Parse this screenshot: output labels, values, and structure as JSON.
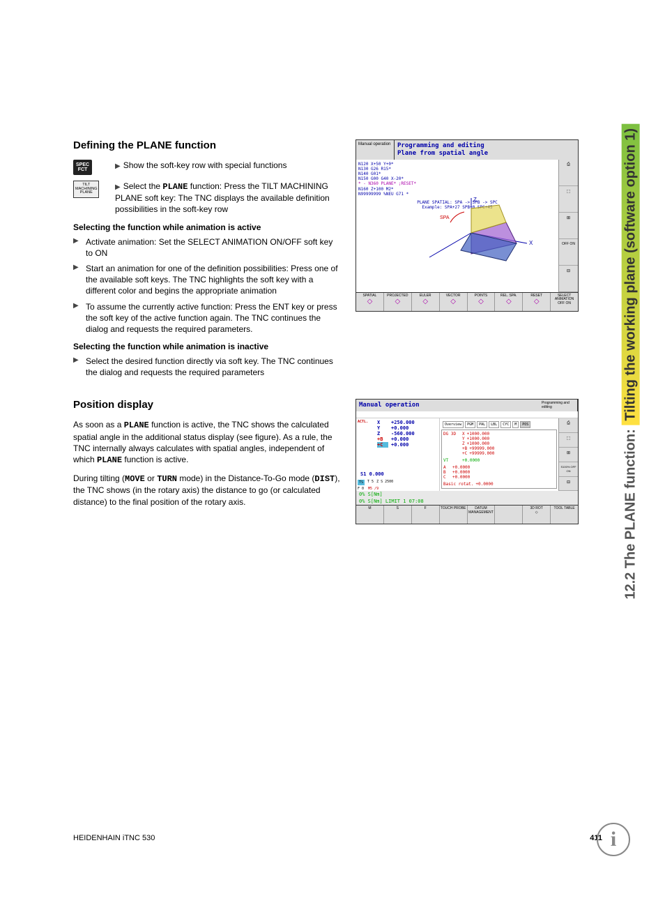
{
  "side_tab": {
    "prefix": "12.2 The PLANE function: ",
    "highlight": "Tilting the working plane (software option 1)"
  },
  "section1": {
    "heading": "Defining the PLANE function",
    "step1": {
      "icon_l1": "SPEC",
      "icon_l2": "FCT",
      "text": "Show the soft-key row with special functions"
    },
    "step2": {
      "icon_l1": "TILT",
      "icon_l2": "MACHINING",
      "icon_l3": "PLANE",
      "pre": "Select the ",
      "bold": "PLANE",
      "post": " function: Press the TILT MACHINING PLANE soft key: The TNC displays the available definition possibilities in the soft-key row"
    },
    "sub1": "Selecting the function while animation is active",
    "b1": "Activate animation: Set the SELECT ANIMATION ON/OFF soft key to ON",
    "b2": "Start an animation for one of the definition possibilities: Press one of the available soft keys. The TNC highlights the soft key with a different color and begins the appropriate animation",
    "b3": "To assume the currently active function: Press the ENT key or press the soft key of the active function again. The TNC continues the dialog and requests the required parameters.",
    "sub2": "Selecting the function while animation is inactive",
    "b4": "Select the desired function directly via soft key. The TNC continues the dialog and requests the required parameters"
  },
  "section2": {
    "heading": "Position display",
    "p1_a": "As soon as a ",
    "p1_b": "PLANE",
    "p1_c": " function is active, the TNC shows the calculated spatial angle in the additional status display (see figure). As a rule, the TNC internally always calculates with spatial angles, independent of which ",
    "p1_d": "PLANE",
    "p1_e": " function is active.",
    "p2_a": "During tilting (",
    "p2_b": "MOVE",
    "p2_c": " or ",
    "p2_d": "TURN",
    "p2_e": " mode) in the Distance-To-Go mode (",
    "p2_f": "DIST",
    "p2_g": "), the TNC shows (in the rotary axis) the distance to go (or calculated distance) to the final position of the rotary axis."
  },
  "screenshot1": {
    "mode": "Manual operation",
    "title_l1": "Programming and editing",
    "title_l2": "Plane from spatial angle",
    "code": [
      "N120 X+50 Y+0*",
      "N130 G26 R15*",
      "N140 G01*",
      "N150 G00 G40 X-20*",
      "* - N360 PLANE* ;RESET*",
      "N160 Z+100 M2*",
      "N99999999 %NEU G71 *"
    ],
    "info_line": "PLANE SPATIAL: SPA -> SPB -> SPC",
    "example_line": "Example: SPA+27 SPB+0 SPC+45",
    "axes": {
      "z": "Z",
      "x": "X",
      "spa": "SPA"
    },
    "softkeys": [
      "SPATIAL",
      "PROJECTED",
      "EULER",
      "VECTOR",
      "POINTS",
      "REL. SPA.",
      "RESET",
      "SELECT ANIMATION OFF ON"
    ],
    "side": [
      "",
      "",
      "",
      "OFF ON",
      ""
    ]
  },
  "screenshot2": {
    "mode_small": "Programming and editing",
    "title": "Manual operation",
    "left_label": "ACTL.",
    "axes": [
      {
        "a": "X",
        "v": "+250.000"
      },
      {
        "a": "Y",
        "v": "+0.000"
      },
      {
        "a": "Z",
        "v": "-560.000"
      },
      {
        "a": "+B",
        "v": "+0.000"
      },
      {
        "a": "+C",
        "v": "+0.000"
      }
    ],
    "s1": "S1  0.000",
    "tabs": [
      "Overview",
      "PGM",
      "PAL",
      "LBL",
      "CYC",
      "M",
      "POS"
    ],
    "dg": {
      "label": "DG 3D",
      "rows": [
        {
          "a": "X",
          "v": "+1000.000"
        },
        {
          "a": "Y",
          "v": "+1000.000"
        },
        {
          "a": "Z",
          "v": "+1000.000"
        },
        {
          "a": "+B",
          "v": "+99999.000"
        },
        {
          "a": "+C",
          "v": "+99999.000"
        }
      ]
    },
    "vt": {
      "label": "VT",
      "v": "+0.0000"
    },
    "abc": [
      {
        "a": "A",
        "v": "+0.0000"
      },
      {
        "a": "B",
        "v": "+0.0000"
      },
      {
        "a": "C",
        "v": "+0.0000"
      }
    ],
    "basic": {
      "label": "Basic rotat.",
      "v": "+0.0000"
    },
    "bottom_row": {
      "ts": "TS",
      "t5": "T 5",
      "zs": "Z S 2500",
      "f0": "F 0",
      "m5": "M5 /9"
    },
    "status1": "0% S[Nm]",
    "status2": "0% S[Nm]  LIMIT 1  07:08",
    "softkeys": [
      "M",
      "S",
      "F",
      "TOUCH PROBE",
      "DATUM MANAGEMENT",
      "",
      "3D ROT",
      "TOOL TABLE"
    ],
    "side": [
      "",
      "",
      "",
      "S100% OFF ON",
      ""
    ]
  },
  "footer": {
    "left": "HEIDENHAIN iTNC 530",
    "page": "411"
  },
  "info_icon": "i"
}
